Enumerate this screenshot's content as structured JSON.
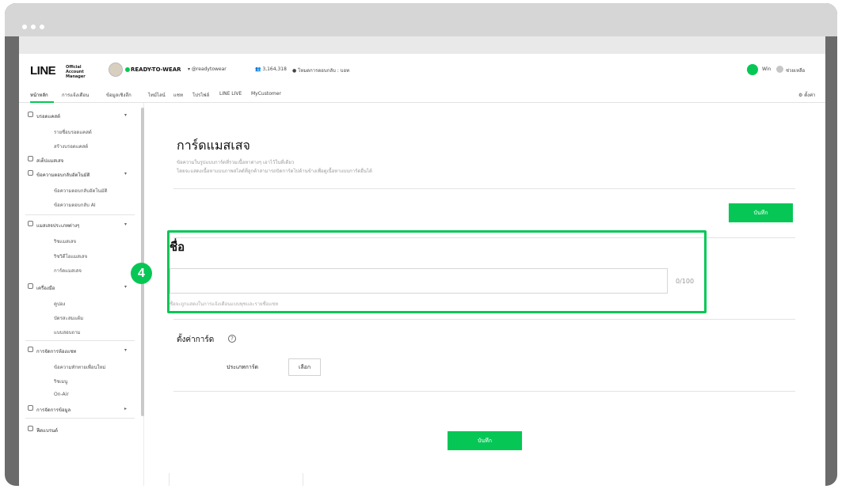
{
  "header": {
    "logo": "LINE",
    "logo_sub": "Official Account Manager",
    "account_name": "READY-TO-WEAR",
    "account_id": "▾ @readytowear",
    "followers": "👥 3,164,318",
    "plan": "● โหมดการตอบกลับ : บอท",
    "user": "Win",
    "help": "ช่วยเหลือ"
  },
  "nav": {
    "items": [
      "หน้าหลัก",
      "การแจ้งเตือน",
      "ข้อมูลเชิงลึก",
      "ไทม์ไลน์",
      "แชท",
      "โปรไฟล์",
      "LINE LIVE",
      "MyCustomer"
    ],
    "settings": "⚙ ตั้งค่า"
  },
  "sidebar": {
    "items": [
      {
        "label": "บรอดแคสต์",
        "type": "sec"
      },
      {
        "label": "รายชื่อบรอดแคสต์",
        "type": "sub"
      },
      {
        "label": "สร้างบรอดแคสต์",
        "type": "sub"
      },
      {
        "label": "สเต็ปแมสเสจ",
        "type": "sec"
      },
      {
        "label": "ข้อความตอบกลับอัตโนมัติ",
        "type": "sec"
      },
      {
        "label": "ข้อความตอบกลับอัตโนมัติ",
        "type": "sub"
      },
      {
        "label": "ข้อความตอบกลับ AI",
        "type": "sub"
      },
      {
        "label": "แมสเสจประเภทต่างๆ",
        "type": "sec"
      },
      {
        "label": "ริชแมสเสจ",
        "type": "sub"
      },
      {
        "label": "ริชวิดีโอแมสเสจ",
        "type": "sub"
      },
      {
        "label": "การ์ดแมสเสจ",
        "type": "sub"
      },
      {
        "label": "เครื่องมือ",
        "type": "sec"
      },
      {
        "label": "คูปอง",
        "type": "sub"
      },
      {
        "label": "บัตรสะสมแต้ม",
        "type": "sub"
      },
      {
        "label": "แบบสอบถาม",
        "type": "sub"
      },
      {
        "label": "การจัดการห้องแชท",
        "type": "sec"
      },
      {
        "label": "ข้อความทักทายเพื่อนใหม่",
        "type": "sub"
      },
      {
        "label": "ริชเมนู",
        "type": "sub"
      },
      {
        "label": "On-Air",
        "type": "sub"
      },
      {
        "label": "การจัดการข้อมูล",
        "type": "sec"
      },
      {
        "label": "ฟีดแบรนด์",
        "type": "sec"
      }
    ]
  },
  "main": {
    "title": "การ์ดแมสเสจ",
    "desc1": "ข้อความในรูปแบบการ์ดที่รวมเนื้อหาต่างๆ เอาไว้ในที่เดียว",
    "desc2": "โดยจะแสดงเนื้อหาแบบภาพสไลด์ที่ลูกค้าสามารถปัดการ์ดไปด้านข้างเพื่อดูเนื้อหาแบบการ์ดอื่นได้",
    "save_label": "บันทึก",
    "name_label": "ชื่อ",
    "name_value": "",
    "name_counter": "0/100",
    "name_hint": "ชื่อจะถูกแสดงในการแจ้งเตือนแบบพุชและรายชื่อแชท",
    "settings_label": "ตั้งค่าการ์ด",
    "card_type_label": "ประเภทการ์ด",
    "select_label": "เลือก",
    "step_number": "4"
  },
  "colors": {
    "accent": "#06c755",
    "frame": "#6b6b6b"
  }
}
